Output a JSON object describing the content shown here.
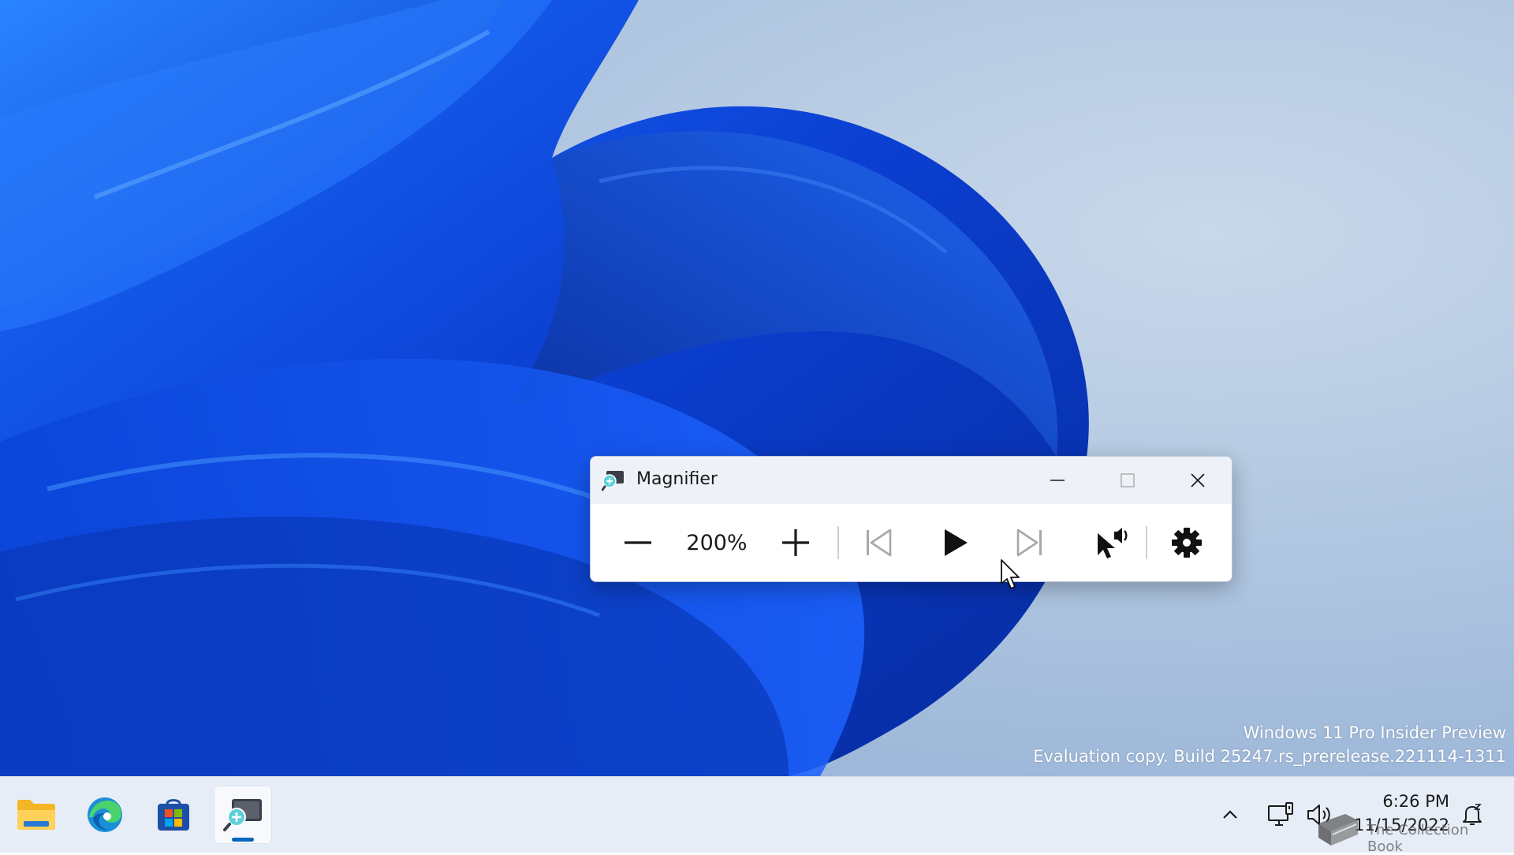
{
  "desktop": {
    "watermark_line1": "Windows 11 Pro Insider Preview",
    "watermark_line2": "Evaluation copy. Build 25247.rs_prerelease.221114-1311"
  },
  "magnifier": {
    "title": "Magnifier",
    "zoom_level": "200%",
    "icons": {
      "app": "magnifier-app-icon",
      "minimize": "minimize-icon",
      "maximize": "maximize-icon",
      "close": "close-icon",
      "zoom_out": "minus-icon",
      "zoom_in": "plus-icon",
      "previous": "skip-previous-icon",
      "play": "play-icon",
      "next": "skip-next-icon",
      "read_from_here": "read-from-here-icon",
      "settings": "gear-icon"
    }
  },
  "taskbar": {
    "apps": [
      {
        "name": "File Explorer",
        "icon": "folder-icon"
      },
      {
        "name": "Microsoft Edge",
        "icon": "edge-icon"
      },
      {
        "name": "Microsoft Store",
        "icon": "store-icon"
      },
      {
        "name": "Magnifier",
        "icon": "magnifier-icon",
        "active": true
      }
    ],
    "tray": {
      "overflow_icon": "chevron-up-icon",
      "network_icon": "network-icon",
      "volume_icon": "volume-icon",
      "notification_icon": "notification-bell-icon"
    },
    "clock": {
      "time": "6:26 PM",
      "date": "11/15/2022"
    },
    "corner_watermark": "The Collection Book"
  },
  "colors": {
    "accent": "#0067c0",
    "wallpaper_blue": "#0a3fd6",
    "taskbar_bg": "#e7edf7"
  }
}
